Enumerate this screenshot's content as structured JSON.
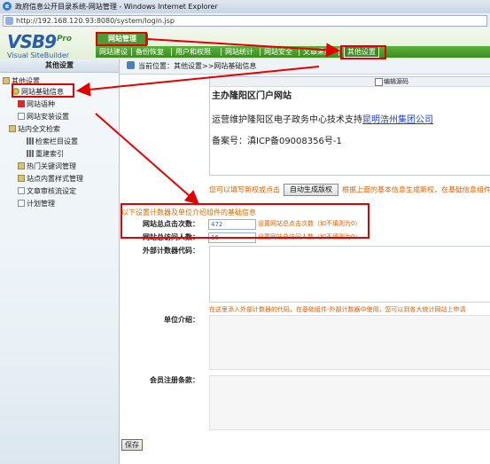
{
  "window": {
    "title": "政府信息公开目录系统-网站管理 - Windows Internet Explorer",
    "url": "http://192.168.120.93:8080/system/login.jsp"
  },
  "logo": {
    "brand": "VSB",
    "version": "9",
    "edition": "Pro",
    "subtitle": "Visual SiteBuilder"
  },
  "top_tab": "网站管理",
  "nav": {
    "items": [
      "网站建设",
      "备份恢复",
      "用户和权限",
      "网站统计",
      "网站安全",
      "文章采集",
      "其他设置"
    ],
    "active": "其他设置"
  },
  "sidebar": {
    "title": "其他设置",
    "items": [
      {
        "label": "其他设置",
        "icon": "folder-icon"
      },
      {
        "label": "网站基础信息",
        "icon": "globe-icon"
      },
      {
        "label": "网站语种",
        "icon": "flag-icon"
      },
      {
        "label": "网站安装设置",
        "icon": "page-icon"
      },
      {
        "label": "站内全文检索",
        "icon": "folder-icon"
      },
      {
        "label": "检索栏目设置",
        "icon": "grid-icon"
      },
      {
        "label": "重建索引",
        "icon": "grid-icon"
      },
      {
        "label": "热门关键词管理",
        "icon": "folder-icon"
      },
      {
        "label": "站点内置样式管理",
        "icon": "folder-icon"
      },
      {
        "label": "文章审核流设定",
        "icon": "page-icon"
      },
      {
        "label": "计划管理",
        "icon": "page-icon"
      }
    ]
  },
  "breadcrumb": "当前位置：其他设置>>网站基础信息",
  "preview": {
    "toolbar_label": "编辑源码",
    "line1": "主办隆阳区门户网站",
    "line2_prefix": "运营维护隆阳区电子政务中心技术支持",
    "line2_link": "昆明浩州集团公司",
    "line3": "备案号：滇ICP备09008356号-1"
  },
  "auto_row": {
    "before": "您可以填写新权或点击",
    "button": "自动生成版权",
    "after": "根据上面的基本信息生成新权，在基础信息组件中"
  },
  "counter_section": {
    "title": "以下设置计数器及单位介绍组件的基础信息",
    "click_label": "网站总点击次数：",
    "click_value": "472",
    "click_hint": "设置网站总点击次数（如不填则为0）",
    "visit_label": "网站总访问人数：",
    "visit_value": "16",
    "visit_hint": "设置网站总访问人数（如不填则为0）"
  },
  "external_counter_label": "外部计数器代码：",
  "external_hint": "在这里添入外部计数器的代码，在基础组件-外部计数器中使用，您可以到各大统计网站上申请",
  "unit_intro_label": "单位介绍：",
  "member_terms_label": "会员注册条款：",
  "save_label": "保存",
  "colors": {
    "nav_green": "#4f9a35",
    "annotation_red": "#e00000",
    "hint_orange": "#e06000",
    "link_blue": "#1a3fcf"
  }
}
